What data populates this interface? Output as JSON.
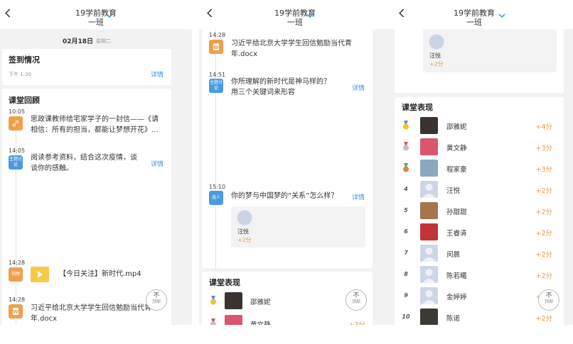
{
  "header": {
    "title_line1": "19学前教育",
    "title_line2": "一班"
  },
  "panel1": {
    "date": "02月18日",
    "weekday": "星期二",
    "checkin": {
      "title": "签到情况",
      "time": "下午 1:30",
      "detail": "详情"
    },
    "review_title": "课堂回顾",
    "items": [
      {
        "time": "10:05",
        "text1": "思政课教师给宅家学子的一封信——《请",
        "text2": "相信：所有的担当，都能让梦想开花》..."
      },
      {
        "time": "14:05",
        "tag": "主题讨论",
        "text1": "阅读参考资料，结合这次疫情，谈",
        "text2": "谈你的感触。",
        "detail": "详情"
      },
      {
        "time": "14:28",
        "tag": "视频",
        "text1": "【今日关注】新时代.mp4"
      },
      {
        "time": "14:28",
        "text1": "习近平给北京大学学生回信勉励当代青",
        "text2": "年.docx"
      }
    ],
    "top_button": {
      "label1": "不",
      "label2": "顶部"
    }
  },
  "panel2": {
    "items": [
      {
        "time": "14:28",
        "text1": "习近平给北京大学学生回信勉励当代青",
        "text2": "年.docx"
      },
      {
        "time": "14:51",
        "tag": "主题讨论",
        "text1": "你所理解的新时代是神马样的？",
        "text2": "用三个关键词来形容",
        "detail": "详情"
      },
      {
        "time": "15:10",
        "tag": "选人",
        "text1": "你的梦与中国梦的“关系”怎么样？",
        "detail": "详情"
      }
    ],
    "reply": {
      "name": "汪悦",
      "points": "+2分"
    },
    "performance_title": "课堂表现",
    "rows": [
      {
        "name": "邵雅妮"
      },
      {
        "name": "黄文静",
        "points": "+3分"
      }
    ],
    "top_button": {
      "label1": "不",
      "label2": "顶部"
    }
  },
  "panel3": {
    "reply": {
      "name": "汪悦",
      "points": "+2分"
    },
    "performance_title": "课堂表现",
    "rows": [
      {
        "rank": "",
        "medal": "gold",
        "name": "邵雅妮",
        "points": "+4分",
        "avatar": "#3b3330"
      },
      {
        "rank": "",
        "medal": "silver",
        "name": "黄文静",
        "points": "+3分",
        "avatar": "#d8566e"
      },
      {
        "rank": "",
        "medal": "bronze",
        "name": "程家豪",
        "points": "+3分",
        "avatar": "#8aa8bf"
      },
      {
        "rank": "4",
        "name": "汪悦",
        "points": "+2分",
        "avatar": ""
      },
      {
        "rank": "5",
        "name": "孙甜甜",
        "points": "+2分",
        "avatar": "#a5754e"
      },
      {
        "rank": "6",
        "name": "王睿清",
        "points": "+2分",
        "avatar": "#c0343c"
      },
      {
        "rank": "7",
        "name": "闵晨",
        "points": "+2分",
        "avatar": ""
      },
      {
        "rank": "8",
        "name": "陈若曦",
        "points": "+2分",
        "avatar": ""
      },
      {
        "rank": "9",
        "name": "金婷婷",
        "points": "+2分",
        "avatar": ""
      },
      {
        "rank": "10",
        "name": "陈诺",
        "points": "+2分",
        "avatar": "#3d3a33"
      }
    ],
    "top_button": {
      "label1": "不",
      "label2": "顶部"
    }
  },
  "colors": {
    "accent_blue": "#3a8ee6",
    "points_orange": "#e89b45",
    "tag_orange": "#f0a04b",
    "tag_blue": "#4a9ae0"
  }
}
